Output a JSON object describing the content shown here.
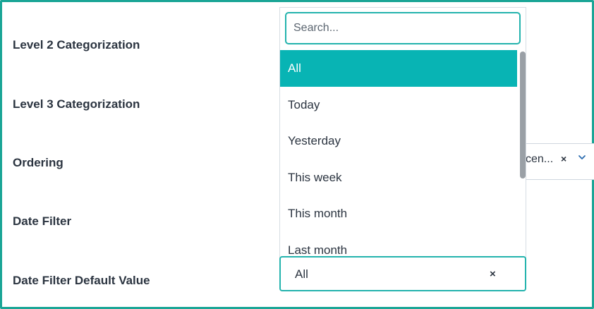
{
  "form": {
    "labels": {
      "level2": "Level 2 Categorization",
      "level3": "Level 3 Categorization",
      "ordering": "Ordering",
      "date_filter": "Date Filter",
      "date_filter_default": "Date Filter Default Value"
    },
    "ordering_value": "cen...",
    "ordering_clear": "×"
  },
  "dropdown": {
    "search_placeholder": "Search...",
    "search_value": "",
    "options": [
      "All",
      "Today",
      "Yesterday",
      "This week",
      "This month",
      "Last month"
    ],
    "selected_index": 0
  },
  "date_filter_default": {
    "value": "All",
    "clear": "×"
  },
  "colors": {
    "accent": "#23b3ad",
    "selected_bg": "#08b4b4",
    "frame": "#1aa596"
  },
  "icons": {
    "clear": "close-icon",
    "chevron": "chevron-down-icon"
  }
}
